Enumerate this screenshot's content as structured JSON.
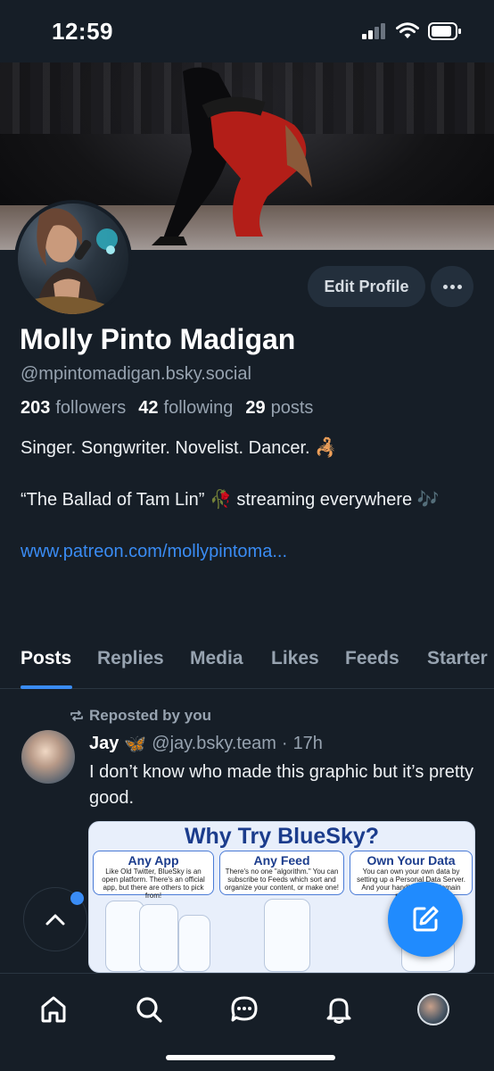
{
  "status_bar": {
    "time": "12:59"
  },
  "profile": {
    "edit_button_label": "Edit Profile",
    "display_name": "Molly Pinto Madigan",
    "handle": "@mpintomadigan.bsky.social",
    "stats": {
      "followers_count": "203",
      "followers_label": "followers",
      "following_count": "42",
      "following_label": "following",
      "posts_count": "29",
      "posts_label": "posts"
    },
    "bio_line1": "Singer. Songwriter. Novelist. Dancer. 🦂",
    "bio_line2": "“The Ballad of Tam Lin” 🥀 streaming everywhere 🎶",
    "link": "www.patreon.com/mollypintoma..."
  },
  "tabs": [
    "Posts",
    "Replies",
    "Media",
    "Likes",
    "Feeds",
    "Starter"
  ],
  "post": {
    "repost_label": "Reposted by you",
    "author_name": "Jay",
    "author_emoji": "🦋",
    "author_handle": "@jay.bsky.team",
    "separator": "·",
    "time_ago": "17h",
    "text": "I don’t know who made this graphic but it’s pretty good.",
    "graphic": {
      "title": "Why Try BlueSky?",
      "cards": [
        {
          "title": "Any App",
          "text": "Like Old Twitter, BlueSky is an open platform. There's an official app, but there are others to pick from!"
        },
        {
          "title": "Any Feed",
          "text": "There's no one \"algorithm.\" You can subscribe to Feeds which sort and organize your content, or make one!"
        },
        {
          "title": "Own Your Data",
          "text": "You can own your own data by setting up a Personal Data Server. And your handle... your domain nam... en."
        }
      ]
    }
  },
  "bottom_nav": [
    "home-icon",
    "search-icon",
    "chat-icon",
    "bell-icon",
    "profile-avatar"
  ],
  "colors": {
    "background": "#161e27",
    "accent": "#208bfe",
    "link": "#3a8cf4",
    "muted": "#97a3b0"
  }
}
